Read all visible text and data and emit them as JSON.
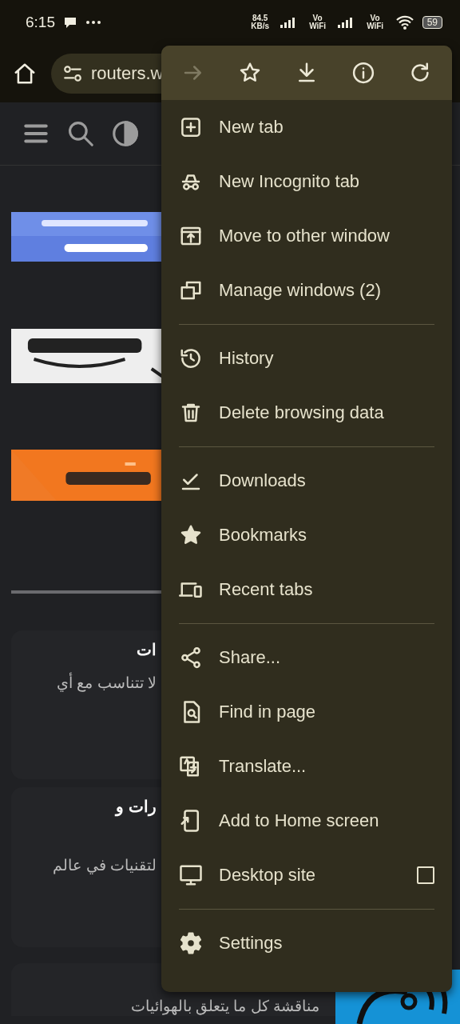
{
  "status_bar": {
    "time": "6:15",
    "speed": "84.5 KB/s",
    "vowifi": [
      "Vo WiFi",
      "Vo WiFi"
    ],
    "battery": "59"
  },
  "toolbar": {
    "url": "routers.w"
  },
  "page": {
    "cards": [
      {
        "title": "ات",
        "text": "لا تتناسب مع أي"
      },
      {
        "title": "رات و",
        "text": "لتقنيات في عالم"
      },
      {
        "text": "مناقشة كل ما يتعلق بالهوائيات"
      }
    ]
  },
  "menu": {
    "actions": [
      {
        "disabled": true
      },
      {
        "disabled": false
      },
      {
        "disabled": false
      },
      {
        "disabled": false
      },
      {
        "disabled": false
      }
    ],
    "sections": [
      [
        {
          "label": "New tab",
          "kind": "plain"
        },
        {
          "label": "New Incognito tab",
          "kind": "plain"
        },
        {
          "label": "Move to other window",
          "kind": "plain"
        },
        {
          "label": "Manage windows (2)",
          "kind": "plain"
        }
      ],
      [
        {
          "label": "History",
          "kind": "plain"
        },
        {
          "label": "Delete browsing data",
          "kind": "plain"
        }
      ],
      [
        {
          "label": "Downloads",
          "kind": "plain"
        },
        {
          "label": "Bookmarks",
          "kind": "plain"
        },
        {
          "label": "Recent tabs",
          "kind": "plain"
        }
      ],
      [
        {
          "label": "Share...",
          "kind": "plain"
        },
        {
          "label": "Find in page",
          "kind": "plain"
        },
        {
          "label": "Translate...",
          "kind": "plain"
        },
        {
          "label": "Add to Home screen",
          "kind": "plain"
        },
        {
          "label": "Desktop site",
          "kind": "checkbox",
          "checked": false
        }
      ],
      [
        {
          "label": "Settings",
          "kind": "plain"
        }
      ]
    ]
  }
}
